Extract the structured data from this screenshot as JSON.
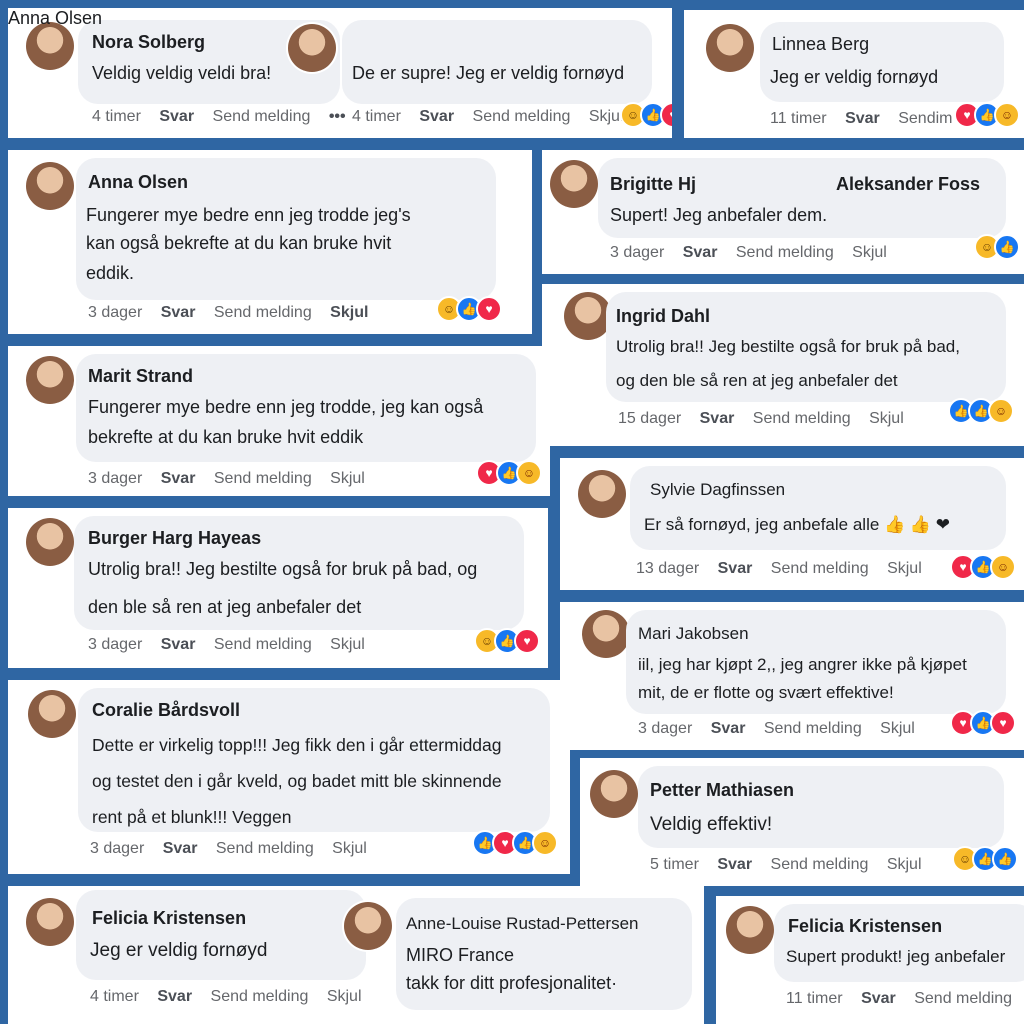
{
  "actions": {
    "reply": "Svar",
    "send_message": "Send melding",
    "hide": "Skjul",
    "send_short": "Sendim",
    "more": "•••"
  },
  "comments": [
    {
      "name": "Nora Solberg",
      "lines": [
        "Veldig veldig veldi bra!"
      ],
      "time": "4 timer",
      "reactions": []
    },
    {
      "name": "Anna Olsen",
      "lines": [
        "De er supre! Jeg er veldig fornøyd"
      ],
      "time": "4 timer",
      "reactions": [
        "haha",
        "like",
        "love"
      ]
    },
    {
      "name": "Linnea Berg",
      "lines": [
        "Jeg er veldig fornøyd"
      ],
      "time": "11 timer",
      "reactions": [
        "love",
        "like",
        "care"
      ]
    },
    {
      "name": "Anna Olsen",
      "lines": [
        "Fungerer mye bedre enn jeg trodde jeg's",
        "kan også bekrefte at du kan bruke hvit",
        "eddik."
      ],
      "time": "3 dager",
      "reactions": [
        "haha",
        "like",
        "love"
      ]
    },
    {
      "name": "Brigitte Hj",
      "extra_name": "Aleksander Foss",
      "lines": [
        "Supert! Jeg anbefaler dem."
      ],
      "time": "3 dager",
      "reactions": [
        "haha",
        "like"
      ]
    },
    {
      "name": "Ingrid Dahl",
      "lines": [
        "Utrolig bra!! Jeg bestilte også for bruk på bad,",
        "og den ble så ren at jeg anbefaler det"
      ],
      "time": "15 dager",
      "reactions": [
        "like",
        "like",
        "care"
      ]
    },
    {
      "name": "Marit Strand",
      "lines": [
        "Fungerer mye bedre enn jeg trodde, jeg kan også",
        "bekrefte at du kan bruke hvit eddik"
      ],
      "time": "3 dager",
      "reactions": [
        "love",
        "like",
        "care"
      ]
    },
    {
      "name": "Sylvie Dagfinssen",
      "lines": [
        "Er så fornøyd, jeg anbefale alle 👍 👍 ❤"
      ],
      "time": "13 dager",
      "reactions": [
        "love",
        "like",
        "care"
      ]
    },
    {
      "name": "Burger Harg Hayeas",
      "lines": [
        "Utrolig bra!! Jeg bestilte også for bruk på bad, og",
        "den ble så ren at jeg anbefaler det"
      ],
      "time": "3 dager",
      "reactions": [
        "haha",
        "like",
        "love"
      ]
    },
    {
      "name": "Mari Jakobsen",
      "lines": [
        "iil, jeg har kjøpt 2,, jeg angrer ikke på kjøpet",
        "mit, de er flotte og svært effektive!"
      ],
      "time": "3 dager",
      "reactions": [
        "love",
        "like",
        "love"
      ]
    },
    {
      "name": "Coralie Bårdsvoll",
      "lines": [
        "Dette er virkelig topp!!! Jeg fikk den i går ettermiddag",
        "og testet den i går kveld, og badet mitt ble skinnende",
        "rent på et blunk!!! Veggen"
      ],
      "time": "3 dager",
      "reactions": [
        "like",
        "love",
        "like",
        "care"
      ]
    },
    {
      "name": "Petter Mathiasen",
      "lines": [
        "Veldig effektiv!"
      ],
      "time": "5 timer",
      "reactions": [
        "haha",
        "like",
        "like"
      ]
    },
    {
      "name": "Felicia Kristensen",
      "lines": [
        "Jeg er veldig fornøyd"
      ],
      "time": "4 timer",
      "reactions": []
    },
    {
      "name": "Anne-Louise Rustad-Pettersen",
      "lines": [
        "MIRO France",
        "takk for ditt profesjonalitet·"
      ],
      "time": "",
      "reactions": []
    },
    {
      "name": "Felicia Kristensen",
      "lines": [
        "Supert produkt! jeg anbefaler"
      ],
      "time": "11 timer",
      "reactions": []
    }
  ]
}
